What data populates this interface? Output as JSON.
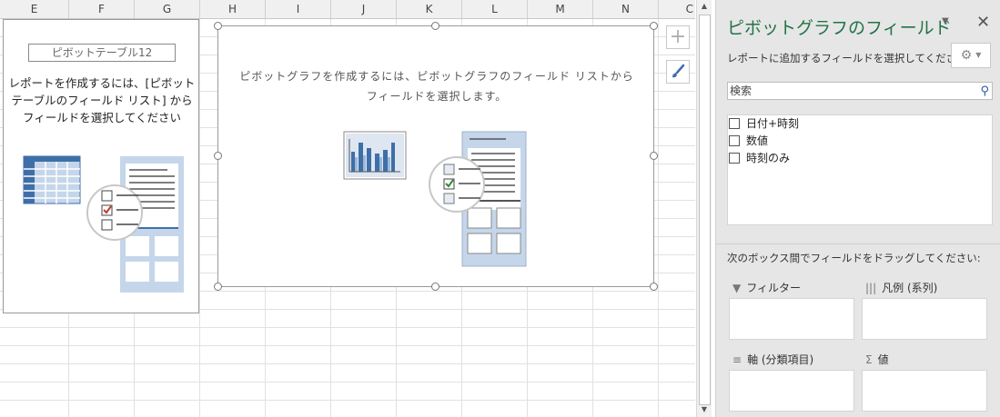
{
  "columns": [
    "E",
    "F",
    "G",
    "H",
    "I",
    "J",
    "K",
    "L",
    "M",
    "N",
    "C"
  ],
  "pivot_table": {
    "name": "ピボットテーブル12",
    "instruction": "レポートを作成するには、[ピボットテーブルのフィールド リスト] からフィールドを選択してください"
  },
  "pivot_chart": {
    "instruction_line1": "ピボットグラフを作成するには、ピボットグラフのフィールド リストから",
    "instruction_line2": "フィールドを選択します。"
  },
  "chart_buttons": {
    "add_elements": "+",
    "styles": "brush"
  },
  "field_pane": {
    "title": "ピボットグラフのフィールド",
    "subtitle": "レポートに追加するフィールドを選択してください:",
    "search_placeholder": "検索",
    "fields": [
      {
        "label": "日付+時刻",
        "checked": false
      },
      {
        "label": "数値",
        "checked": false
      },
      {
        "label": "時刻のみ",
        "checked": false
      }
    ],
    "drag_instruction": "次のボックス間でフィールドをドラッグしてください:",
    "areas": {
      "filter": "フィルター",
      "legend": "凡例 (系列)",
      "axis": "軸 (分類項目)",
      "values": "値"
    }
  },
  "colors": {
    "accent_green": "#217346",
    "illustration_blue": "#3f6fa8",
    "illustration_light": "#c5d6ea",
    "check_green": "#2e8b2e",
    "check_red": "#c0392b"
  }
}
